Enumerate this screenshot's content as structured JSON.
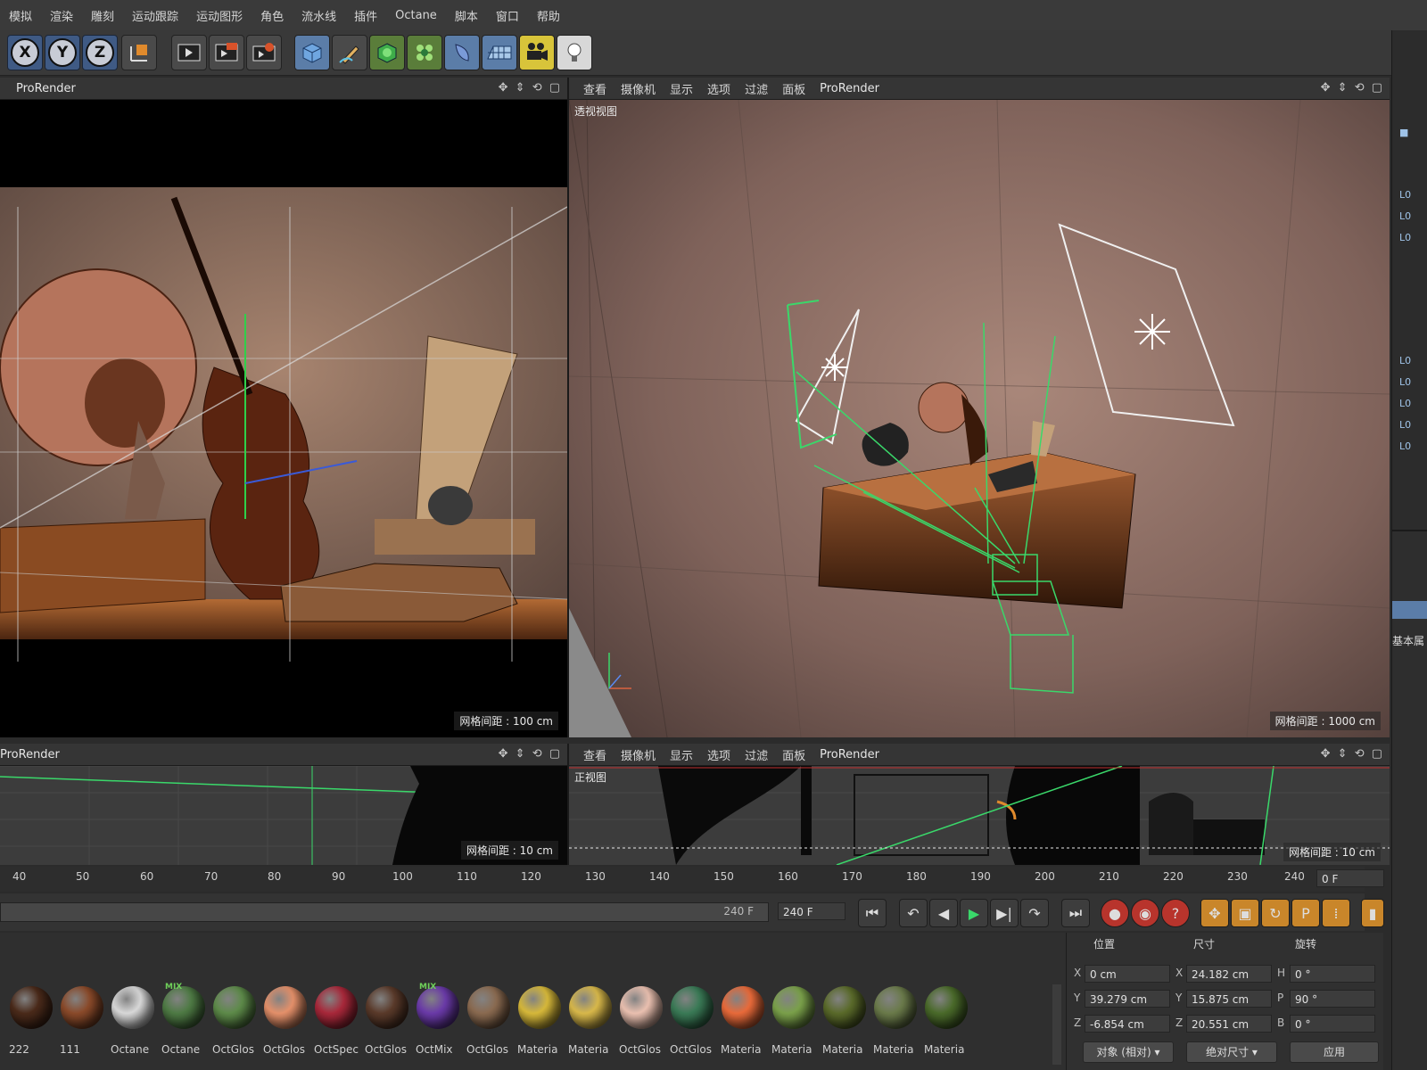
{
  "menu": [
    "模拟",
    "渲染",
    "雕刻",
    "运动跟踪",
    "运动图形",
    "角色",
    "流水线",
    "插件",
    "Octane",
    "脚本",
    "窗口",
    "帮助"
  ],
  "toolbar": {
    "axis_labels": [
      "X",
      "Y",
      "Z"
    ],
    "icons": [
      "coordinate-system-icon",
      "render-view-icon",
      "render-to-picture-viewer-icon",
      "render-settings-icon",
      "cube-icon",
      "pen-icon",
      "subdivision-icon",
      "cloner-icon",
      "deformer-icon",
      "floor-icon",
      "camera-icon",
      "light-icon"
    ]
  },
  "viewports": {
    "top_left": {
      "header": "ProRender",
      "grid": "网格间距 : 100 cm"
    },
    "top_right": {
      "menu": [
        "查看",
        "摄像机",
        "显示",
        "选项",
        "过滤",
        "面板"
      ],
      "renderer": "ProRender",
      "title": "透视视图",
      "grid": "网格间距 : 1000 cm"
    },
    "bottom_left": {
      "header": "ProRender",
      "grid": "网格间距 : 10 cm"
    },
    "bottom_right": {
      "menu": [
        "查看",
        "摄像机",
        "显示",
        "选项",
        "过滤",
        "面板"
      ],
      "renderer": "ProRender",
      "title": "正视图",
      "grid": "网格间距 : 10 cm"
    }
  },
  "timeline": {
    "ticks": [
      "40",
      "50",
      "60",
      "70",
      "80",
      "90",
      "100",
      "110",
      "120",
      "130",
      "140",
      "150",
      "160",
      "170",
      "180",
      "190",
      "200",
      "210",
      "220",
      "230",
      "240"
    ],
    "current_frame": "0 F",
    "end_frame_label": "240 F",
    "end_frame_field": "240 F"
  },
  "materials": [
    {
      "name": "222",
      "color": "#4a2a1a",
      "mix": false
    },
    {
      "name": "111",
      "color": "#8a4a2a",
      "mix": false
    },
    {
      "name": "Octane",
      "color": "#d8d8d8",
      "mix": false
    },
    {
      "name": "Octane",
      "color": "#4e7a44",
      "mix": true
    },
    {
      "name": "OctGlos",
      "color": "#5d8a49",
      "mix": false
    },
    {
      "name": "OctGlos",
      "color": "#e4906a",
      "mix": false
    },
    {
      "name": "OctSpec",
      "color": "#a8283a",
      "mix": false
    },
    {
      "name": "OctGlos",
      "color": "#5a3a2a",
      "mix": false
    },
    {
      "name": "OctMix",
      "color": "#6a3aa8",
      "mix": true
    },
    {
      "name": "OctGlos",
      "color": "#8a6a50",
      "mix": false
    },
    {
      "name": "Materia",
      "color": "#d6b83a",
      "mix": false
    },
    {
      "name": "Materia",
      "color": "#d8b84a",
      "mix": false
    },
    {
      "name": "OctGlos",
      "color": "#eac0b0",
      "mix": false
    },
    {
      "name": "OctGlos",
      "color": "#3a7a56",
      "mix": false
    },
    {
      "name": "Materia",
      "color": "#e86a3a",
      "mix": false
    },
    {
      "name": "Materia",
      "color": "#7aa04a",
      "mix": false
    },
    {
      "name": "Materia",
      "color": "#5a6a2a",
      "mix": false
    },
    {
      "name": "Materia",
      "color": "#6a7a4a",
      "mix": false
    },
    {
      "name": "Materia",
      "color": "#4a6a2a",
      "mix": false
    }
  ],
  "coords": {
    "headers": [
      "位置",
      "尺寸",
      "旋转"
    ],
    "position": {
      "x": "0 cm",
      "y": "39.279 cm",
      "z": "-6.854 cm"
    },
    "size": {
      "x": "24.182 cm",
      "y": "15.875 cm",
      "z": "20.551 cm"
    },
    "rotation": {
      "h": "0 °",
      "p": "90 °",
      "b": "0 °"
    },
    "labels": {
      "x": "X",
      "y": "Y",
      "z": "Z",
      "h": "H",
      "p": "P",
      "b": "B"
    },
    "mode_dropdown": "对象 (相对)",
    "size_dropdown": "绝对尺寸",
    "apply_button": "应用"
  },
  "right_panel": {
    "label": "基本属"
  }
}
